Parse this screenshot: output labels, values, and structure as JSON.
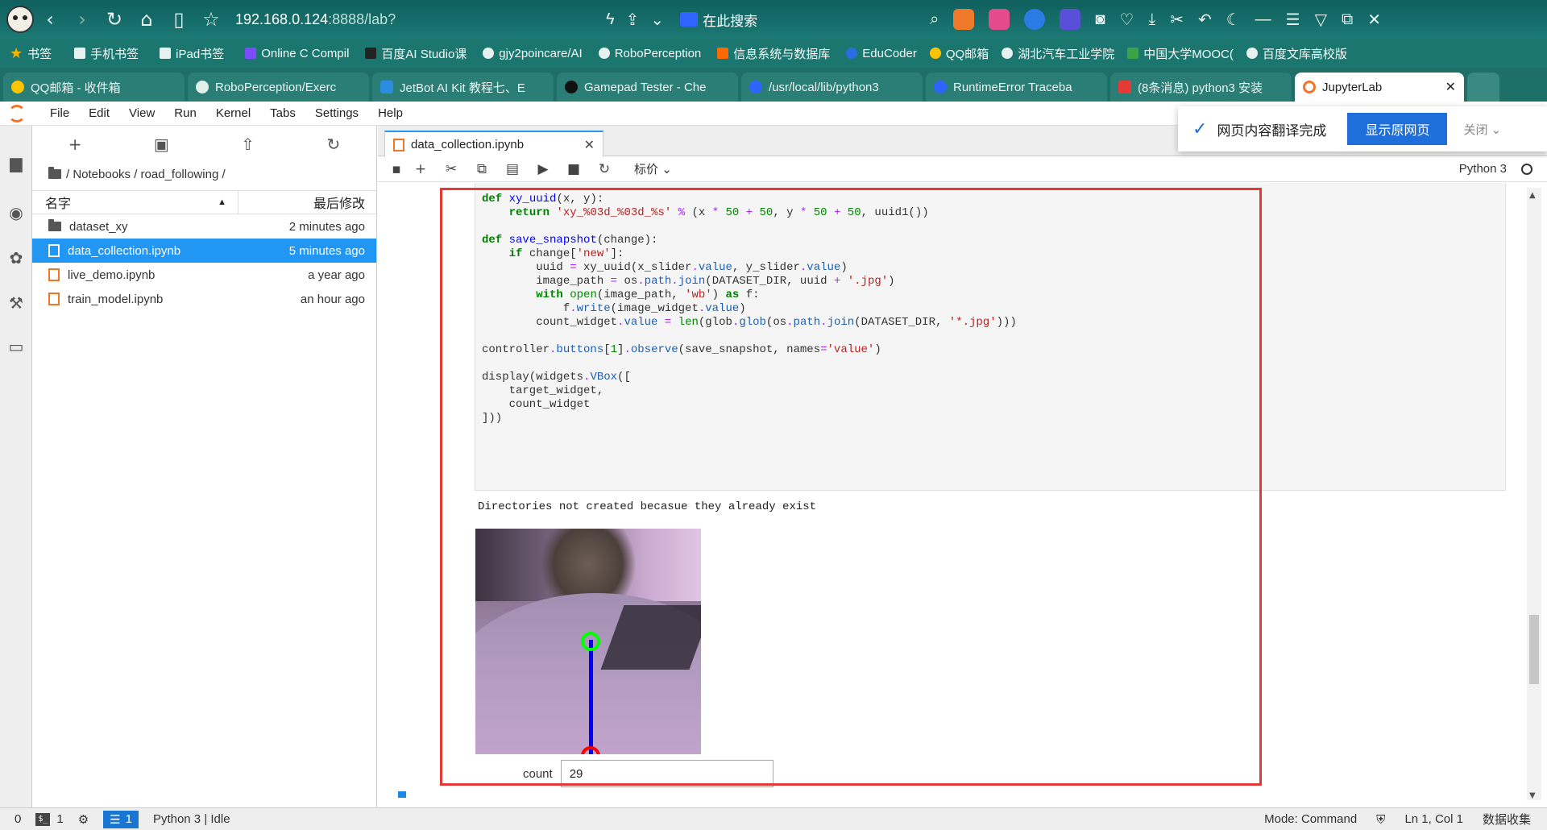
{
  "browser": {
    "url_host": "192.168.0.124",
    "url_rest": ":8888/lab?",
    "search_label": "在此搜索",
    "bookmarks": [
      "书签",
      "手机书签",
      "iPad书签",
      "Online C Compil",
      "百度AI Studio课",
      "gjy2poincare/AI",
      "RoboPerception",
      "信息系统与数据库",
      "EduCoder",
      "QQ邮箱",
      "湖北汽车工业学院",
      "中国大学MOOC(",
      "百度文库高校版"
    ],
    "tabs": [
      "QQ邮箱 - 收件箱",
      "RoboPerception/Exerc",
      "JetBot AI Kit 教程七、E",
      "Gamepad Tester - Che",
      "/usr/local/lib/python3",
      "RuntimeError Traceba",
      "(8条消息) python3 安装",
      "JupyterLab"
    ]
  },
  "menubar": [
    "File",
    "Edit",
    "View",
    "Run",
    "Kernel",
    "Tabs",
    "Settings",
    "Help"
  ],
  "translate_popup": {
    "message": "网页内容翻译完成",
    "button": "显示原网页",
    "close": "关闭"
  },
  "filebrowser": {
    "path": "/ Notebooks / road_following /",
    "col_name": "名字",
    "col_modified": "最后修改",
    "rows": [
      {
        "name": "dataset_xy",
        "modified": "2 minutes ago"
      },
      {
        "name": "data_collection.ipynb",
        "modified": "5 minutes ago"
      },
      {
        "name": "live_demo.ipynb",
        "modified": "a year ago"
      },
      {
        "name": "train_model.ipynb",
        "modified": "an hour ago"
      }
    ]
  },
  "notebook": {
    "tab_title": "data_collection.ipynb",
    "cell_type": "标价",
    "kernel": "Python 3",
    "output_text": "Directories not created becasue they already exist",
    "count_label": "count",
    "count_value": "29"
  },
  "statusbar": {
    "zero": "0",
    "terminals": "1",
    "tabs_count": "1",
    "kernel_status": "Python 3 | Idle",
    "mode": "Mode: Command",
    "position": "Ln 1, Col 1",
    "extra": "数据收集"
  },
  "colors": {
    "accent": "#2196f3",
    "highlight_border": "#e53935",
    "jupyter_orange": "#f37626"
  }
}
